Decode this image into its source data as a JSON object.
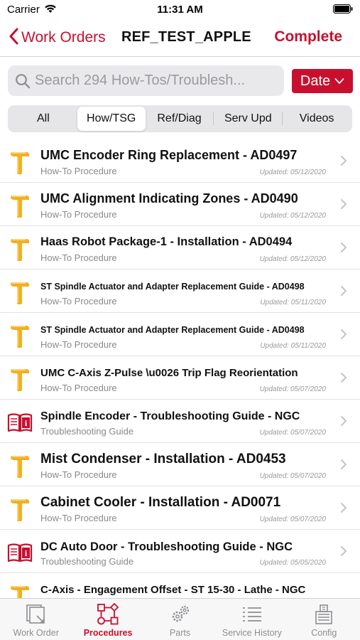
{
  "status_bar": {
    "carrier": "Carrier",
    "time": "11:31 AM"
  },
  "nav": {
    "back_label": "Work Orders",
    "title": "REF_TEST_APPLE",
    "action_label": "Complete"
  },
  "search": {
    "placeholder": "Search 294 How-Tos/Troublesh...",
    "value": "",
    "sort_label": "Date"
  },
  "segments": [
    {
      "label": "All",
      "active": false
    },
    {
      "label": "How/TSG",
      "active": true
    },
    {
      "label": "Ref/Diag",
      "active": false
    },
    {
      "label": "Serv Upd",
      "active": false
    },
    {
      "label": "Videos",
      "active": false
    }
  ],
  "items": [
    {
      "title": "UMC Encoder Ring Replacement - AD0497",
      "subtitle": "How-To Procedure",
      "date": "Updated: 05/12/2020",
      "icon": "hammer-icon"
    },
    {
      "title": "UMC Alignment Indicating Zones - AD0490",
      "subtitle": "How-To Procedure",
      "date": "Updated: 05/12/2020",
      "icon": "hammer-icon"
    },
    {
      "title": "Haas Robot Package-1 - Installation - AD0494",
      "subtitle": "How-To Procedure",
      "date": "Updated: 05/12/2020",
      "icon": "hammer-icon"
    },
    {
      "title": "ST Spindle Actuator and Adapter Replacement Guide - AD0498",
      "subtitle": "How-To Procedure",
      "date": "Updated: 05/11/2020",
      "icon": "hammer-icon"
    },
    {
      "title": "ST Spindle Actuator and Adapter Replacement Guide - AD0498",
      "subtitle": "How-To Procedure",
      "date": "Updated: 05/11/2020",
      "icon": "hammer-icon"
    },
    {
      "title": "UMC C-Axis Z-Pulse \\u0026 Trip Flag Reorientation",
      "subtitle": "How-To Procedure",
      "date": "Updated: 05/07/2020",
      "icon": "hammer-icon"
    },
    {
      "title": "Spindle Encoder - Troubleshooting Guide - NGC",
      "subtitle": "Troubleshooting Guide",
      "date": "Updated: 05/07/2020",
      "icon": "book-info-icon"
    },
    {
      "title": "Mist Condenser - Installation - AD0453",
      "subtitle": "How-To Procedure",
      "date": "Updated: 05/07/2020",
      "icon": "hammer-icon"
    },
    {
      "title": "Cabinet Cooler - Installation - AD0071",
      "subtitle": "How-To Procedure",
      "date": "Updated: 05/07/2020",
      "icon": "hammer-icon"
    },
    {
      "title": "DC Auto Door - Troubleshooting Guide - NGC",
      "subtitle": "Troubleshooting Guide",
      "date": "Updated: 05/05/2020",
      "icon": "book-info-icon"
    },
    {
      "title": "C-Axis - Engagement Offset - ST 15-30 - Lathe - NGC",
      "subtitle": "",
      "date": "",
      "icon": "hammer-icon"
    }
  ],
  "tabs": [
    {
      "label": "Work Order",
      "icon": "work-order-icon",
      "active": false
    },
    {
      "label": "Procedures",
      "icon": "procedures-icon",
      "active": true
    },
    {
      "label": "Parts",
      "icon": "gears-icon",
      "active": false
    },
    {
      "label": "Service History",
      "icon": "list-icon",
      "active": false
    },
    {
      "label": "Config",
      "icon": "config-icon",
      "active": false
    }
  ],
  "colors": {
    "accent": "#c8102e",
    "hammer": "#f2b01e",
    "inactive": "#8e8e93"
  }
}
